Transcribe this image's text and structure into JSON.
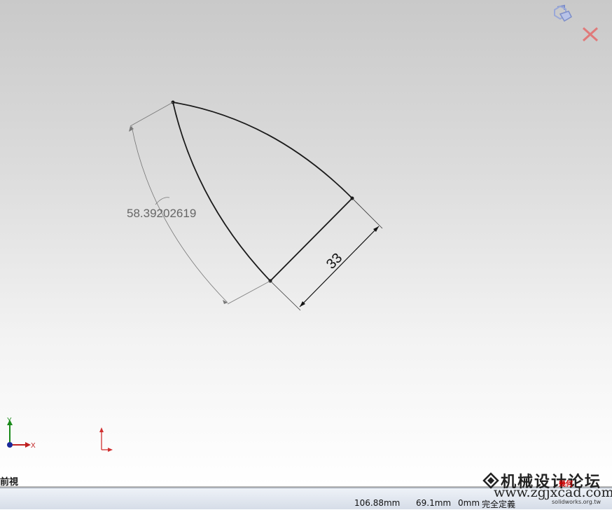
{
  "sketch": {
    "angle_dimension": "58.39202619",
    "linear_dimension": "33"
  },
  "triad": {
    "y_label": "Y",
    "x_label": "X"
  },
  "view": {
    "name": "前視"
  },
  "status": {
    "x": "106.88mm",
    "y": "69.1mm",
    "z": "0mm",
    "state": "完全定義"
  },
  "watermark": {
    "title": "机械设计论坛",
    "url": "www.zgjxcad.com",
    "badge": "幾何",
    "small": "solidworks.org.tw"
  },
  "colors": {
    "sketch_line": "#1a1a1a",
    "dimension": "#555555",
    "accent_red": "#d03030",
    "triad_x": "#c02020",
    "triad_y": "#1a8a1a",
    "triad_z": "#1a2a9a"
  }
}
